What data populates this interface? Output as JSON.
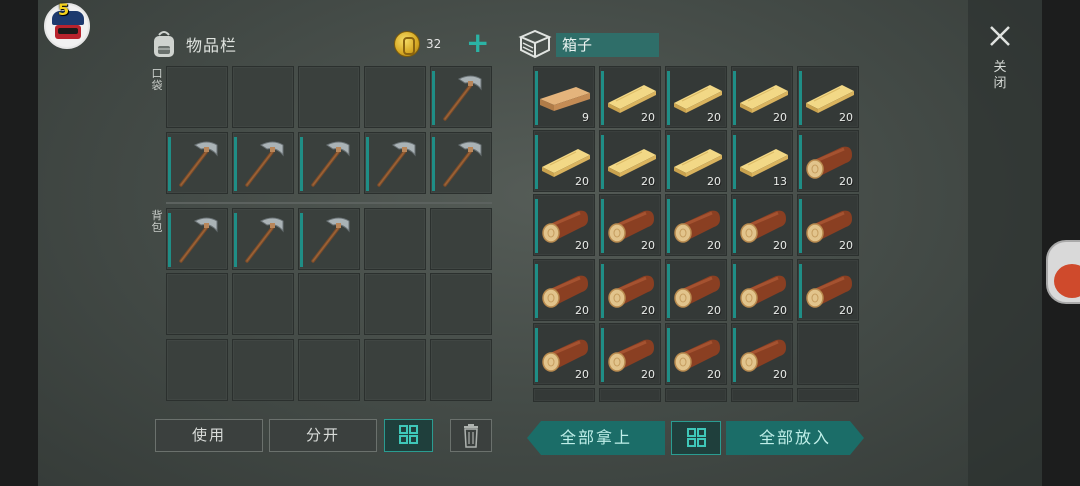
{
  "player": {
    "level": "5"
  },
  "inventory": {
    "title": "物品栏",
    "coins": "32",
    "pocket_label": "口袋",
    "backpack_label": "背包",
    "pocket_items": [
      {
        "item": null
      },
      {
        "item": null
      },
      {
        "item": null
      },
      {
        "item": null
      },
      {
        "item": "pickaxe"
      },
      {
        "item": "pickaxe"
      },
      {
        "item": "pickaxe"
      },
      {
        "item": "pickaxe"
      },
      {
        "item": "pickaxe"
      },
      {
        "item": "pickaxe"
      }
    ],
    "backpack_items": [
      {
        "item": "pickaxe"
      },
      {
        "item": "pickaxe"
      },
      {
        "item": "pickaxe"
      },
      {
        "item": null
      },
      {
        "item": null
      },
      {
        "item": null
      },
      {
        "item": null
      },
      {
        "item": null
      },
      {
        "item": null
      },
      {
        "item": null
      },
      {
        "item": null
      },
      {
        "item": null
      },
      {
        "item": null
      },
      {
        "item": null
      },
      {
        "item": null
      }
    ],
    "buttons": {
      "use": "使用",
      "split": "分开"
    }
  },
  "chest": {
    "title": "箱子",
    "slots": [
      {
        "item": "plank-dark",
        "count": "9"
      },
      {
        "item": "plank",
        "count": "20"
      },
      {
        "item": "plank",
        "count": "20"
      },
      {
        "item": "plank",
        "count": "20"
      },
      {
        "item": "plank",
        "count": "20"
      },
      {
        "item": "plank",
        "count": "20"
      },
      {
        "item": "plank",
        "count": "20"
      },
      {
        "item": "plank",
        "count": "20"
      },
      {
        "item": "plank",
        "count": "13"
      },
      {
        "item": "log",
        "count": "20"
      },
      {
        "item": "log",
        "count": "20"
      },
      {
        "item": "log",
        "count": "20"
      },
      {
        "item": "log",
        "count": "20"
      },
      {
        "item": "log",
        "count": "20"
      },
      {
        "item": "log",
        "count": "20"
      },
      {
        "item": "log",
        "count": "20"
      },
      {
        "item": "log",
        "count": "20"
      },
      {
        "item": "log",
        "count": "20"
      },
      {
        "item": "log",
        "count": "20"
      },
      {
        "item": "log",
        "count": "20"
      },
      {
        "item": "log",
        "count": "20"
      },
      {
        "item": "log",
        "count": "20"
      },
      {
        "item": "log",
        "count": "20"
      },
      {
        "item": "log",
        "count": "20"
      },
      {
        "item": null,
        "count": ""
      }
    ],
    "buttons": {
      "take_all": "全部拿上",
      "put_all": "全部放入"
    }
  },
  "close": {
    "label": "关闭"
  },
  "colors": {
    "accent": "#1f8e86",
    "teal_button": "#1b6d68",
    "gold": "#d6a823"
  }
}
